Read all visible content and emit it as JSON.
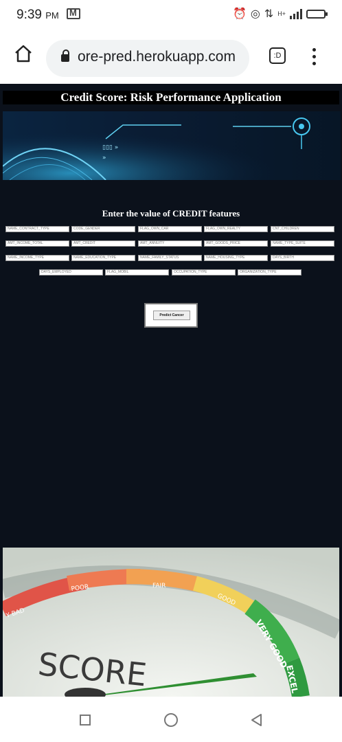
{
  "status_bar": {
    "time": "9:39",
    "ampm": "PM",
    "network": "H+"
  },
  "browser": {
    "url": "ore-pred.herokuapp.com",
    "tab_label": ":D"
  },
  "page": {
    "title": "Credit Score: Risk Performance Application",
    "subtitle": "Enter the value of CREDIT features",
    "fields": [
      "NAME_CONTRACT_TYPE",
      "CODE_GENDER",
      "FLAG_OWN_CAR",
      "FLAG_OWN_REALTY",
      "CNT_CHILDREN",
      "AMT_INCOME_TOTAL",
      "AMT_CREDIT",
      "AMT_ANNUITY",
      "AMT_GOODS_PRICE",
      "NAME_TYPE_SUITE",
      "NAME_INCOME_TYPE",
      "NAME_EDUCATION_TYPE",
      "NAME_FAMILY_STATUS",
      "NAME_HOUSING_TYPE",
      "DAYS_BIRTH",
      "DAYS_EMPLOYED",
      "FLAG_MOBIL",
      "OCCUPATION_TYPE",
      "ORGANIZATION_TYPE"
    ],
    "predict_label": "Predict Cancer",
    "gauge": {
      "word": "SCORE",
      "bands": [
        "Y BAD",
        "POOR",
        "FAIR",
        "GOOD",
        "VERY GOOD",
        "EXCEL"
      ]
    }
  },
  "colors": {
    "page_bg": "#0b111b",
    "title_bg": "#000000"
  }
}
